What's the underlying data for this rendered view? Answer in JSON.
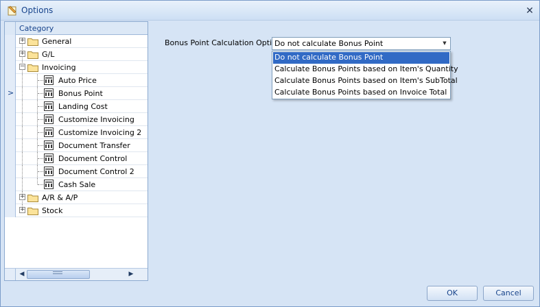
{
  "window": {
    "title": "Options",
    "close_glyph": "✕"
  },
  "tree": {
    "header": "Category",
    "rows": [
      {
        "label": "General",
        "type": "folder",
        "level": 0,
        "expander": "+"
      },
      {
        "label": "G/L",
        "type": "folder",
        "level": 0,
        "expander": "+"
      },
      {
        "label": "Invoicing",
        "type": "folder",
        "level": 0,
        "expander": "−"
      },
      {
        "label": "Auto Price",
        "type": "page",
        "level": 1
      },
      {
        "label": "Bonus Point",
        "type": "page",
        "level": 1,
        "focused": true
      },
      {
        "label": "Landing Cost",
        "type": "page",
        "level": 1
      },
      {
        "label": "Customize Invoicing",
        "type": "page",
        "level": 1
      },
      {
        "label": "Customize Invoicing 2",
        "type": "page",
        "level": 1
      },
      {
        "label": "Document Transfer",
        "type": "page",
        "level": 1
      },
      {
        "label": "Document Control",
        "type": "page",
        "level": 1
      },
      {
        "label": "Document Control 2",
        "type": "page",
        "level": 1
      },
      {
        "label": "Cash Sale",
        "type": "page",
        "level": 1
      },
      {
        "label": "A/R & A/P",
        "type": "folder",
        "level": 0,
        "expander": "+"
      },
      {
        "label": "Stock",
        "type": "folder",
        "level": 0,
        "expander": "+"
      }
    ],
    "focus_arrow": ">",
    "scroll_left": "◀",
    "scroll_right": "▶"
  },
  "settings": {
    "label": "Bonus Point Calculation Option",
    "selected": "Do not calculate Bonus Point",
    "options": [
      "Do not calculate Bonus Point",
      "Calculate Bonus Points based on Item's Quantity",
      "Calculate Bonus Points based on Item's SubTotal",
      "Calculate Bonus Points based on Invoice Total"
    ],
    "combo_arrow": "▼"
  },
  "buttons": {
    "ok": "OK",
    "cancel": "Cancel"
  },
  "colors": {
    "accent": "#316ac5",
    "title": "#15428b",
    "background": "#d6e4f5"
  }
}
